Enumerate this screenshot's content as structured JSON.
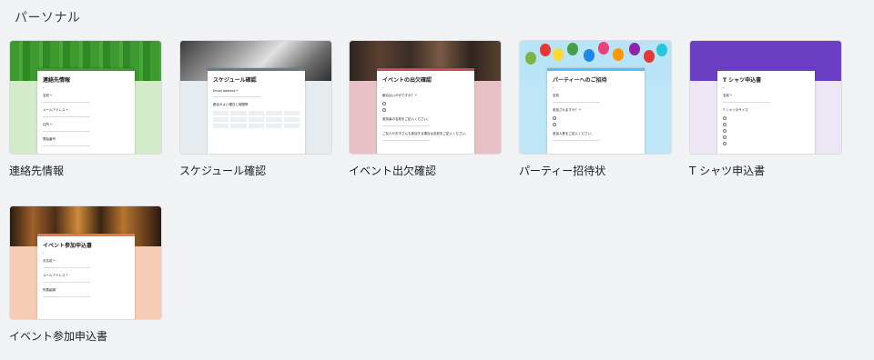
{
  "section": {
    "title": "パーソナル"
  },
  "templates": [
    {
      "label": "連絡先情報",
      "lower_color": "#d2ecc9",
      "accent": "#3c9a2f",
      "form_title": "連絡先情報",
      "fields": [
        "名前 *",
        "メールアドレス *",
        "住所 *",
        "電話番号"
      ]
    },
    {
      "label": "スケジュール確認",
      "lower_color": "#e5ebee",
      "accent": "#607d8b",
      "form_title": "スケジュール確認",
      "fields": [
        "Email address *",
        "都合のよい曜日と時間帯"
      ]
    },
    {
      "label": "イベント出欠確認",
      "lower_color": "#e8c1c6",
      "accent": "#c94a5a",
      "form_title": "イベントの出欠確認",
      "fields": [
        "都合はいかがですか？ *",
        "参加者の名前をご記入ください。",
        "ご友人やお子さんも参加する場合は名前をご記入ください。"
      ]
    },
    {
      "label": "パーティー招待状",
      "lower_color": "#bfe6f7",
      "accent": "#4fc3f7",
      "form_title": "パーティーへのご招待",
      "fields": [
        "名前",
        "参加されますか？ *",
        "参加人数をご記入ください。"
      ]
    },
    {
      "label": "T シャツ申込書",
      "lower_color": "#ece6f5",
      "accent": "#6c3fc4",
      "form_title": "T シャツ申込書",
      "fields": [
        "名前 *",
        "T シャツのサイズ"
      ]
    },
    {
      "label": "イベント参加申込書",
      "lower_color": "#f7ccb6",
      "accent": "#e07b4a",
      "form_title": "イベント参加申込書",
      "fields": [
        "お名前 *",
        "メールアドレス *",
        "所属組織"
      ]
    }
  ]
}
